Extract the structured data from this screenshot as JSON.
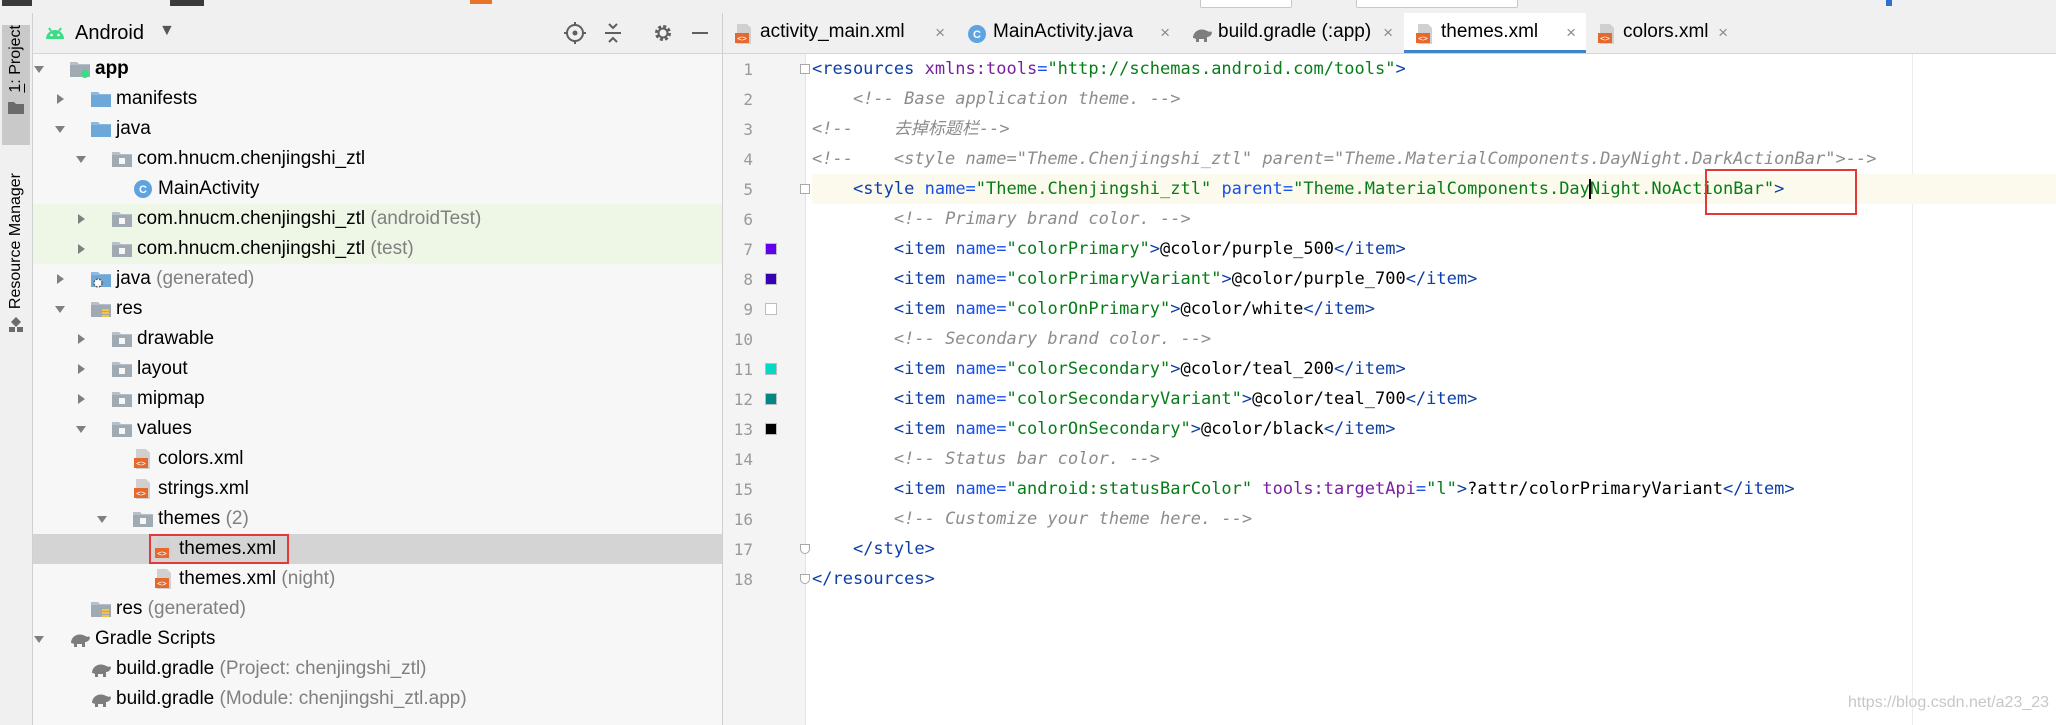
{
  "project_panel": {
    "view_mode": "Android",
    "header_icons": [
      "target-icon",
      "collapse-all-icon",
      "gear-icon",
      "minimize-icon"
    ],
    "tree": [
      {
        "depth": 0,
        "expanded": true,
        "icon": "app-module-icon",
        "label": "app",
        "suffix": "",
        "bold": true
      },
      {
        "depth": 1,
        "expanded": false,
        "icon": "folder-icon",
        "label": "manifests",
        "suffix": ""
      },
      {
        "depth": 1,
        "expanded": true,
        "icon": "folder-icon",
        "label": "java",
        "suffix": ""
      },
      {
        "depth": 2,
        "expanded": true,
        "icon": "package-icon",
        "label": "com.hnucm.chenjingshi_ztl",
        "suffix": ""
      },
      {
        "depth": 3,
        "expanded": null,
        "icon": "class-icon",
        "label": "MainActivity",
        "suffix": ""
      },
      {
        "depth": 2,
        "expanded": false,
        "icon": "package-icon",
        "label": "com.hnucm.chenjingshi_ztl",
        "suffix": "(androidTest)",
        "tint": true
      },
      {
        "depth": 2,
        "expanded": false,
        "icon": "package-icon",
        "label": "com.hnucm.chenjingshi_ztl",
        "suffix": "(test)",
        "tint": true
      },
      {
        "depth": 1,
        "expanded": false,
        "icon": "generated-folder-icon",
        "label": "java",
        "suffix": "(generated)"
      },
      {
        "depth": 1,
        "expanded": true,
        "icon": "res-folder-icon",
        "label": "res",
        "suffix": ""
      },
      {
        "depth": 2,
        "expanded": false,
        "icon": "package-icon",
        "label": "drawable",
        "suffix": ""
      },
      {
        "depth": 2,
        "expanded": false,
        "icon": "package-icon",
        "label": "layout",
        "suffix": ""
      },
      {
        "depth": 2,
        "expanded": false,
        "icon": "package-icon",
        "label": "mipmap",
        "suffix": ""
      },
      {
        "depth": 2,
        "expanded": true,
        "icon": "package-icon",
        "label": "values",
        "suffix": ""
      },
      {
        "depth": 3,
        "expanded": null,
        "icon": "xml-file-icon",
        "label": "colors.xml",
        "suffix": ""
      },
      {
        "depth": 3,
        "expanded": null,
        "icon": "xml-file-icon",
        "label": "strings.xml",
        "suffix": ""
      },
      {
        "depth": 3,
        "expanded": true,
        "icon": "package-icon",
        "label": "themes",
        "suffix": "(2)"
      },
      {
        "depth": 4,
        "expanded": null,
        "icon": "xml-file-icon",
        "label": "themes.xml",
        "suffix": "",
        "selected": true
      },
      {
        "depth": 4,
        "expanded": null,
        "icon": "xml-file-icon",
        "label": "themes.xml",
        "suffix": "(night)"
      },
      {
        "depth": 1,
        "expanded": null,
        "icon": "res-folder-icon",
        "label": "res",
        "suffix": "(generated)"
      },
      {
        "depth": 0,
        "expanded": true,
        "icon": "gradle-icon",
        "label": "Gradle Scripts",
        "suffix": ""
      },
      {
        "depth": 1,
        "expanded": null,
        "icon": "gradle-icon",
        "label": "build.gradle",
        "suffix": "(Project: chenjingshi_ztl)"
      },
      {
        "depth": 1,
        "expanded": null,
        "icon": "gradle-icon",
        "label": "build.gradle",
        "suffix": "(Module: chenjingshi_ztl.app)"
      }
    ]
  },
  "tool_strip": {
    "project_tab": {
      "number": "1",
      "label": ": Project"
    },
    "resource_tab": {
      "label": "Resource Manager"
    }
  },
  "tabs": [
    {
      "label": "activity_main.xml",
      "icon": "xml-file-icon",
      "active": false
    },
    {
      "label": "MainActivity.java",
      "icon": "class-icon",
      "active": false
    },
    {
      "label": "build.gradle (:app)",
      "icon": "gradle-icon",
      "active": false
    },
    {
      "label": "themes.xml",
      "icon": "xml-file-icon",
      "active": true
    },
    {
      "label": "colors.xml",
      "icon": "xml-file-icon",
      "active": false
    }
  ],
  "tab_close_glyph": "×",
  "editor": {
    "current_line": 5,
    "swatches": {
      "7": "#6200EE",
      "8": "#3700B3",
      "9": "#FFFFFF",
      "11": "#03DAC5",
      "12": "#018786",
      "13": "#000000"
    },
    "lines": [
      [
        [
          "t-tag",
          "<resources "
        ],
        [
          "t-ns",
          "xmlns:tools"
        ],
        [
          "t-attr",
          "="
        ],
        [
          "t-str",
          "\"http://schemas.android.com/tools\""
        ],
        [
          "t-tag",
          ">"
        ]
      ],
      [
        [
          "t-plain",
          "    "
        ],
        [
          "t-com",
          "<!-- Base application theme. -->"
        ]
      ],
      [
        [
          "t-com",
          "<!--    去掉标题栏-->"
        ]
      ],
      [
        [
          "t-com",
          "<!--    <style name=\"Theme.Chenjingshi_ztl\" parent=\"Theme.MaterialComponents.DayNight.DarkActionBar\">-->"
        ]
      ],
      [
        [
          "t-plain",
          "    "
        ],
        [
          "t-tag",
          "<style "
        ],
        [
          "t-attr",
          "name="
        ],
        [
          "t-str",
          "\"Theme.Chenjingshi_ztl\" "
        ],
        [
          "t-attr",
          "parent="
        ],
        [
          "t-str",
          "\"Theme.MaterialComponents.Day"
        ],
        [
          "cursor",
          ""
        ],
        [
          "t-str",
          "Night.NoActionBar\""
        ],
        [
          "t-tag",
          ">"
        ]
      ],
      [
        [
          "t-plain",
          "        "
        ],
        [
          "t-com",
          "<!-- Primary brand color. -->"
        ]
      ],
      [
        [
          "t-plain",
          "        "
        ],
        [
          "t-tag",
          "<item "
        ],
        [
          "t-attr",
          "name="
        ],
        [
          "t-str",
          "\"colorPrimary\""
        ],
        [
          "t-tag",
          ">"
        ],
        [
          "t-plain",
          "@color/purple_500"
        ],
        [
          "t-tag",
          "</item>"
        ]
      ],
      [
        [
          "t-plain",
          "        "
        ],
        [
          "t-tag",
          "<item "
        ],
        [
          "t-attr",
          "name="
        ],
        [
          "t-str",
          "\"colorPrimaryVariant\""
        ],
        [
          "t-tag",
          ">"
        ],
        [
          "t-plain",
          "@color/purple_700"
        ],
        [
          "t-tag",
          "</item>"
        ]
      ],
      [
        [
          "t-plain",
          "        "
        ],
        [
          "t-tag",
          "<item "
        ],
        [
          "t-attr",
          "name="
        ],
        [
          "t-str",
          "\"colorOnPrimary\""
        ],
        [
          "t-tag",
          ">"
        ],
        [
          "t-plain",
          "@color/white"
        ],
        [
          "t-tag",
          "</item>"
        ]
      ],
      [
        [
          "t-plain",
          "        "
        ],
        [
          "t-com",
          "<!-- Secondary brand color. -->"
        ]
      ],
      [
        [
          "t-plain",
          "        "
        ],
        [
          "t-tag",
          "<item "
        ],
        [
          "t-attr",
          "name="
        ],
        [
          "t-str",
          "\"colorSecondary\""
        ],
        [
          "t-tag",
          ">"
        ],
        [
          "t-plain",
          "@color/teal_200"
        ],
        [
          "t-tag",
          "</item>"
        ]
      ],
      [
        [
          "t-plain",
          "        "
        ],
        [
          "t-tag",
          "<item "
        ],
        [
          "t-attr",
          "name="
        ],
        [
          "t-str",
          "\"colorSecondaryVariant\""
        ],
        [
          "t-tag",
          ">"
        ],
        [
          "t-plain",
          "@color/teal_700"
        ],
        [
          "t-tag",
          "</item>"
        ]
      ],
      [
        [
          "t-plain",
          "        "
        ],
        [
          "t-tag",
          "<item "
        ],
        [
          "t-attr",
          "name="
        ],
        [
          "t-str",
          "\"colorOnSecondary\""
        ],
        [
          "t-tag",
          ">"
        ],
        [
          "t-plain",
          "@color/black"
        ],
        [
          "t-tag",
          "</item>"
        ]
      ],
      [
        [
          "t-plain",
          "        "
        ],
        [
          "t-com",
          "<!-- Status bar color. -->"
        ]
      ],
      [
        [
          "t-plain",
          "        "
        ],
        [
          "t-tag",
          "<item "
        ],
        [
          "t-attr",
          "name="
        ],
        [
          "t-str",
          "\"android:statusBarColor\" "
        ],
        [
          "t-ns",
          "tools:targetApi"
        ],
        [
          "t-attr",
          "="
        ],
        [
          "t-str",
          "\"l\""
        ],
        [
          "t-tag",
          ">"
        ],
        [
          "t-plain",
          "?attr/colorPrimaryVariant"
        ],
        [
          "t-tag",
          "</item>"
        ]
      ],
      [
        [
          "t-plain",
          "        "
        ],
        [
          "t-com",
          "<!-- Customize your theme here. -->"
        ]
      ],
      [
        [
          "t-plain",
          "    "
        ],
        [
          "t-tag",
          "</style>"
        ]
      ],
      [
        [
          "t-tag",
          "</"
        ],
        [
          "t-tag",
          "resources"
        ],
        [
          "t-tag",
          ">"
        ]
      ]
    ]
  },
  "watermark": "https://blog.csdn.net/a23_23"
}
